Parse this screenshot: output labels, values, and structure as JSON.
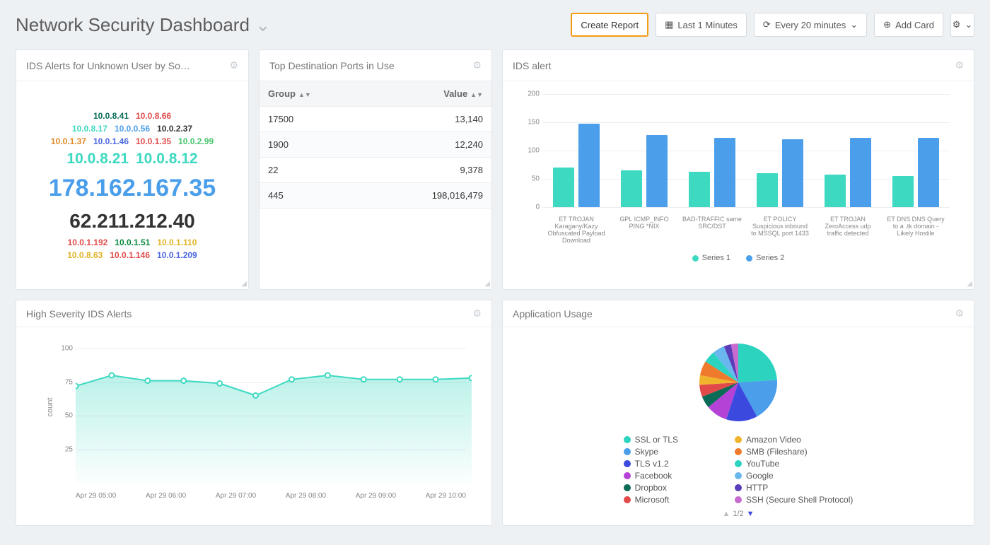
{
  "header": {
    "title": "Network Security Dashboard",
    "create_report_label": "Create Report",
    "timerange_label": "Last 1 Minutes",
    "refresh_label": "Every 20 minutes",
    "add_card_label": "Add Card"
  },
  "card_wordcloud": {
    "title": "IDS Alerts for Unknown User by So…",
    "rows": [
      [
        {
          "ip": "10.0.8.41",
          "color": "#0a6b57",
          "size": 12
        },
        {
          "ip": "10.0.8.66",
          "color": "#e24a4a",
          "size": 12
        }
      ],
      [
        {
          "ip": "10.0.8.17",
          "color": "#3dd9c1",
          "size": 12
        },
        {
          "ip": "10.0.0.56",
          "color": "#4a9eea",
          "size": 12
        },
        {
          "ip": "10.0.2.37",
          "color": "#333333",
          "size": 12
        }
      ],
      [
        {
          "ip": "10.0.1.37",
          "color": "#e08a24",
          "size": 12
        },
        {
          "ip": "10.0.1.46",
          "color": "#4a66e0",
          "size": 12
        },
        {
          "ip": "10.0.1.35",
          "color": "#e24a4a",
          "size": 12
        },
        {
          "ip": "10.0.2.99",
          "color": "#46c46b",
          "size": 12
        }
      ],
      [
        {
          "ip": "10.0.8.21",
          "color": "#3dd9c1",
          "size": 21
        },
        {
          "ip": "10.0.8.12",
          "color": "#3dd9c1",
          "size": 21
        }
      ],
      [
        {
          "ip": "178.162.167.35",
          "color": "#4a9eea",
          "size": 34
        }
      ],
      [
        {
          "ip": "62.211.212.40",
          "color": "#333333",
          "size": 28
        }
      ],
      [
        {
          "ip": "10.0.1.192",
          "color": "#e24a4a",
          "size": 12
        },
        {
          "ip": "10.0.1.51",
          "color": "#0a8a3d",
          "size": 12
        },
        {
          "ip": "10.0.1.110",
          "color": "#e0b324",
          "size": 12
        }
      ],
      [
        {
          "ip": "10.0.8.63",
          "color": "#e0b324",
          "size": 12
        },
        {
          "ip": "10.0.1.146",
          "color": "#e24a4a",
          "size": 12
        },
        {
          "ip": "10.0.1.209",
          "color": "#4a66e0",
          "size": 12
        }
      ]
    ]
  },
  "card_ports": {
    "title": "Top Destination Ports in Use",
    "columns": {
      "group": "Group",
      "value": "Value"
    },
    "rows": [
      {
        "group": "17500",
        "value": "13,140"
      },
      {
        "group": "1900",
        "value": "12,240"
      },
      {
        "group": "22",
        "value": "9,378"
      },
      {
        "group": "445",
        "value": "198,016,479"
      }
    ]
  },
  "card_ids_bar": {
    "title": "IDS alert"
  },
  "card_area": {
    "title": "High Severity IDS Alerts"
  },
  "card_pie": {
    "title": "Application Usage",
    "pager": "1/2"
  },
  "chart_data": [
    {
      "id": "ids_bar",
      "type": "bar",
      "title": "IDS alert",
      "categories": [
        "ET TROJAN Karagany/Kazy Obfuscated Payload Download",
        "GPL ICMP_INFO PING *NIX",
        "BAD-TRAFFIC same SRC/DST",
        "ET POLICY Suspicious inbound to MSSQL port 1433",
        "ET TROJAN ZeroAccess udp traffic detected",
        "ET DNS DNS Query to a .tk domain - Likely Hostile"
      ],
      "series": [
        {
          "name": "Series 1",
          "color": "#3dd9c1",
          "values": [
            70,
            65,
            63,
            60,
            58,
            55
          ]
        },
        {
          "name": "Series 2",
          "color": "#4a9eea",
          "values": [
            147,
            127,
            122,
            120,
            123,
            122
          ]
        }
      ],
      "ylim": [
        0,
        200
      ],
      "yticks": [
        0,
        50,
        100,
        150,
        200
      ]
    },
    {
      "id": "high_sev_area",
      "type": "area",
      "title": "High Severity IDS Alerts",
      "ylabel": "count",
      "x": [
        "Apr 29 05:00",
        "Apr 29 06:00",
        "Apr 29 07:00",
        "Apr 29 08:00",
        "Apr 29 09:00",
        "Apr 29 10:00"
      ],
      "values": [
        72,
        80,
        76,
        76,
        74,
        65,
        77,
        80,
        77,
        77,
        77,
        78
      ],
      "ylim": [
        0,
        100
      ],
      "yticks": [
        25,
        50,
        75,
        100
      ],
      "color": "#3dd9c1"
    },
    {
      "id": "app_usage_pie",
      "type": "pie",
      "title": "Application Usage",
      "slices": [
        {
          "name": "SSL or TLS",
          "value": 24,
          "color": "#2cd4c0"
        },
        {
          "name": "Skype",
          "value": 18,
          "color": "#4a9eea"
        },
        {
          "name": "TLS v1.2",
          "value": 13,
          "color": "#3b49df"
        },
        {
          "name": "Facebook",
          "value": 9,
          "color": "#b542d6"
        },
        {
          "name": "Dropbox",
          "value": 5,
          "color": "#0a6b57"
        },
        {
          "name": "Microsoft",
          "value": 5,
          "color": "#e24a4a"
        },
        {
          "name": "Amazon Video",
          "value": 4,
          "color": "#f0b42c"
        },
        {
          "name": "SMB (Fileshare)",
          "value": 6,
          "color": "#f07a2c"
        },
        {
          "name": "YouTube",
          "value": 5,
          "color": "#2cd4c0"
        },
        {
          "name": "Google",
          "value": 5,
          "color": "#6ab7f0"
        },
        {
          "name": "HTTP",
          "value": 3,
          "color": "#5a3db8"
        },
        {
          "name": "SSH (Secure Shell Protocol)",
          "value": 3,
          "color": "#c86bd0"
        }
      ]
    }
  ]
}
